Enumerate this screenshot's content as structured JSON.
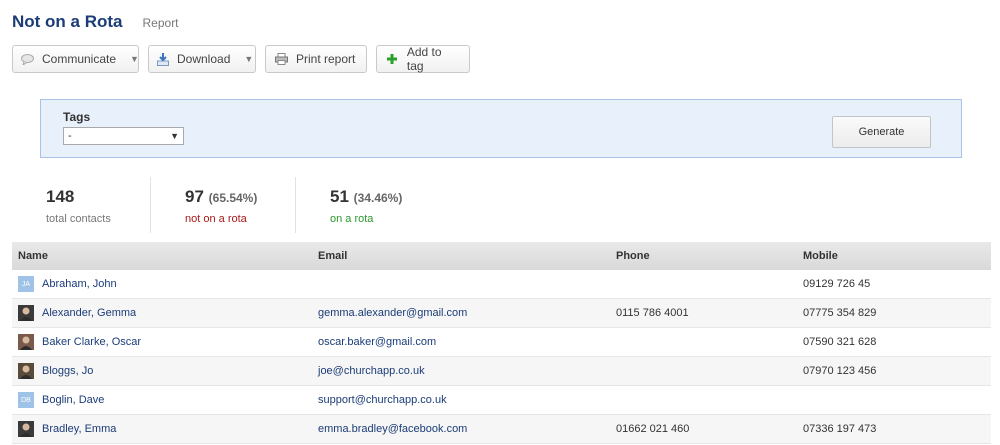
{
  "header": {
    "title": "Not on a Rota",
    "subtitle": "Report"
  },
  "toolbar": {
    "communicate": "Communicate",
    "download": "Download",
    "print": "Print report",
    "add_to_tag": "Add to tag"
  },
  "filter": {
    "label": "Tags",
    "selected": "-",
    "generate": "Generate"
  },
  "stats": [
    {
      "value": "148",
      "pct": "",
      "label": "total contacts"
    },
    {
      "value": "97",
      "pct": "(65.54%)",
      "label": "not on a rota"
    },
    {
      "value": "51",
      "pct": "(34.46%)",
      "label": "on a rota"
    }
  ],
  "table": {
    "headers": {
      "name": "Name",
      "email": "Email",
      "phone": "Phone",
      "mobile": "Mobile"
    },
    "rows": [
      {
        "avatar": "initials",
        "initials": "JA",
        "name": "Abraham, John",
        "email": "",
        "phone": "",
        "mobile": "09129 726 45"
      },
      {
        "avatar": "photo",
        "initials": "",
        "name": "Alexander, Gemma",
        "email": "gemma.alexander@gmail.com",
        "phone": "0115 786 4001",
        "mobile": "07775 354 829"
      },
      {
        "avatar": "photo",
        "initials": "",
        "name": "Baker Clarke, Oscar",
        "email": "oscar.baker@gmail.com",
        "phone": "",
        "mobile": "07590 321 628"
      },
      {
        "avatar": "photo",
        "initials": "",
        "name": "Bloggs, Jo",
        "email": "joe@churchapp.co.uk",
        "phone": "",
        "mobile": "07970 123 456"
      },
      {
        "avatar": "initials",
        "initials": "DB",
        "name": "Boglin, Dave",
        "email": "support@churchapp.co.uk",
        "phone": "",
        "mobile": ""
      },
      {
        "avatar": "photo",
        "initials": "",
        "name": "Bradley, Emma",
        "email": "emma.bradley@facebook.com",
        "phone": "01662 021 460",
        "mobile": "07336 197 473"
      }
    ]
  },
  "colors": {
    "title": "#1b3c78",
    "link": "#1b3c78",
    "red": "#a81b1b",
    "green": "#2b9a2b",
    "panel": "#e8f0fb"
  }
}
